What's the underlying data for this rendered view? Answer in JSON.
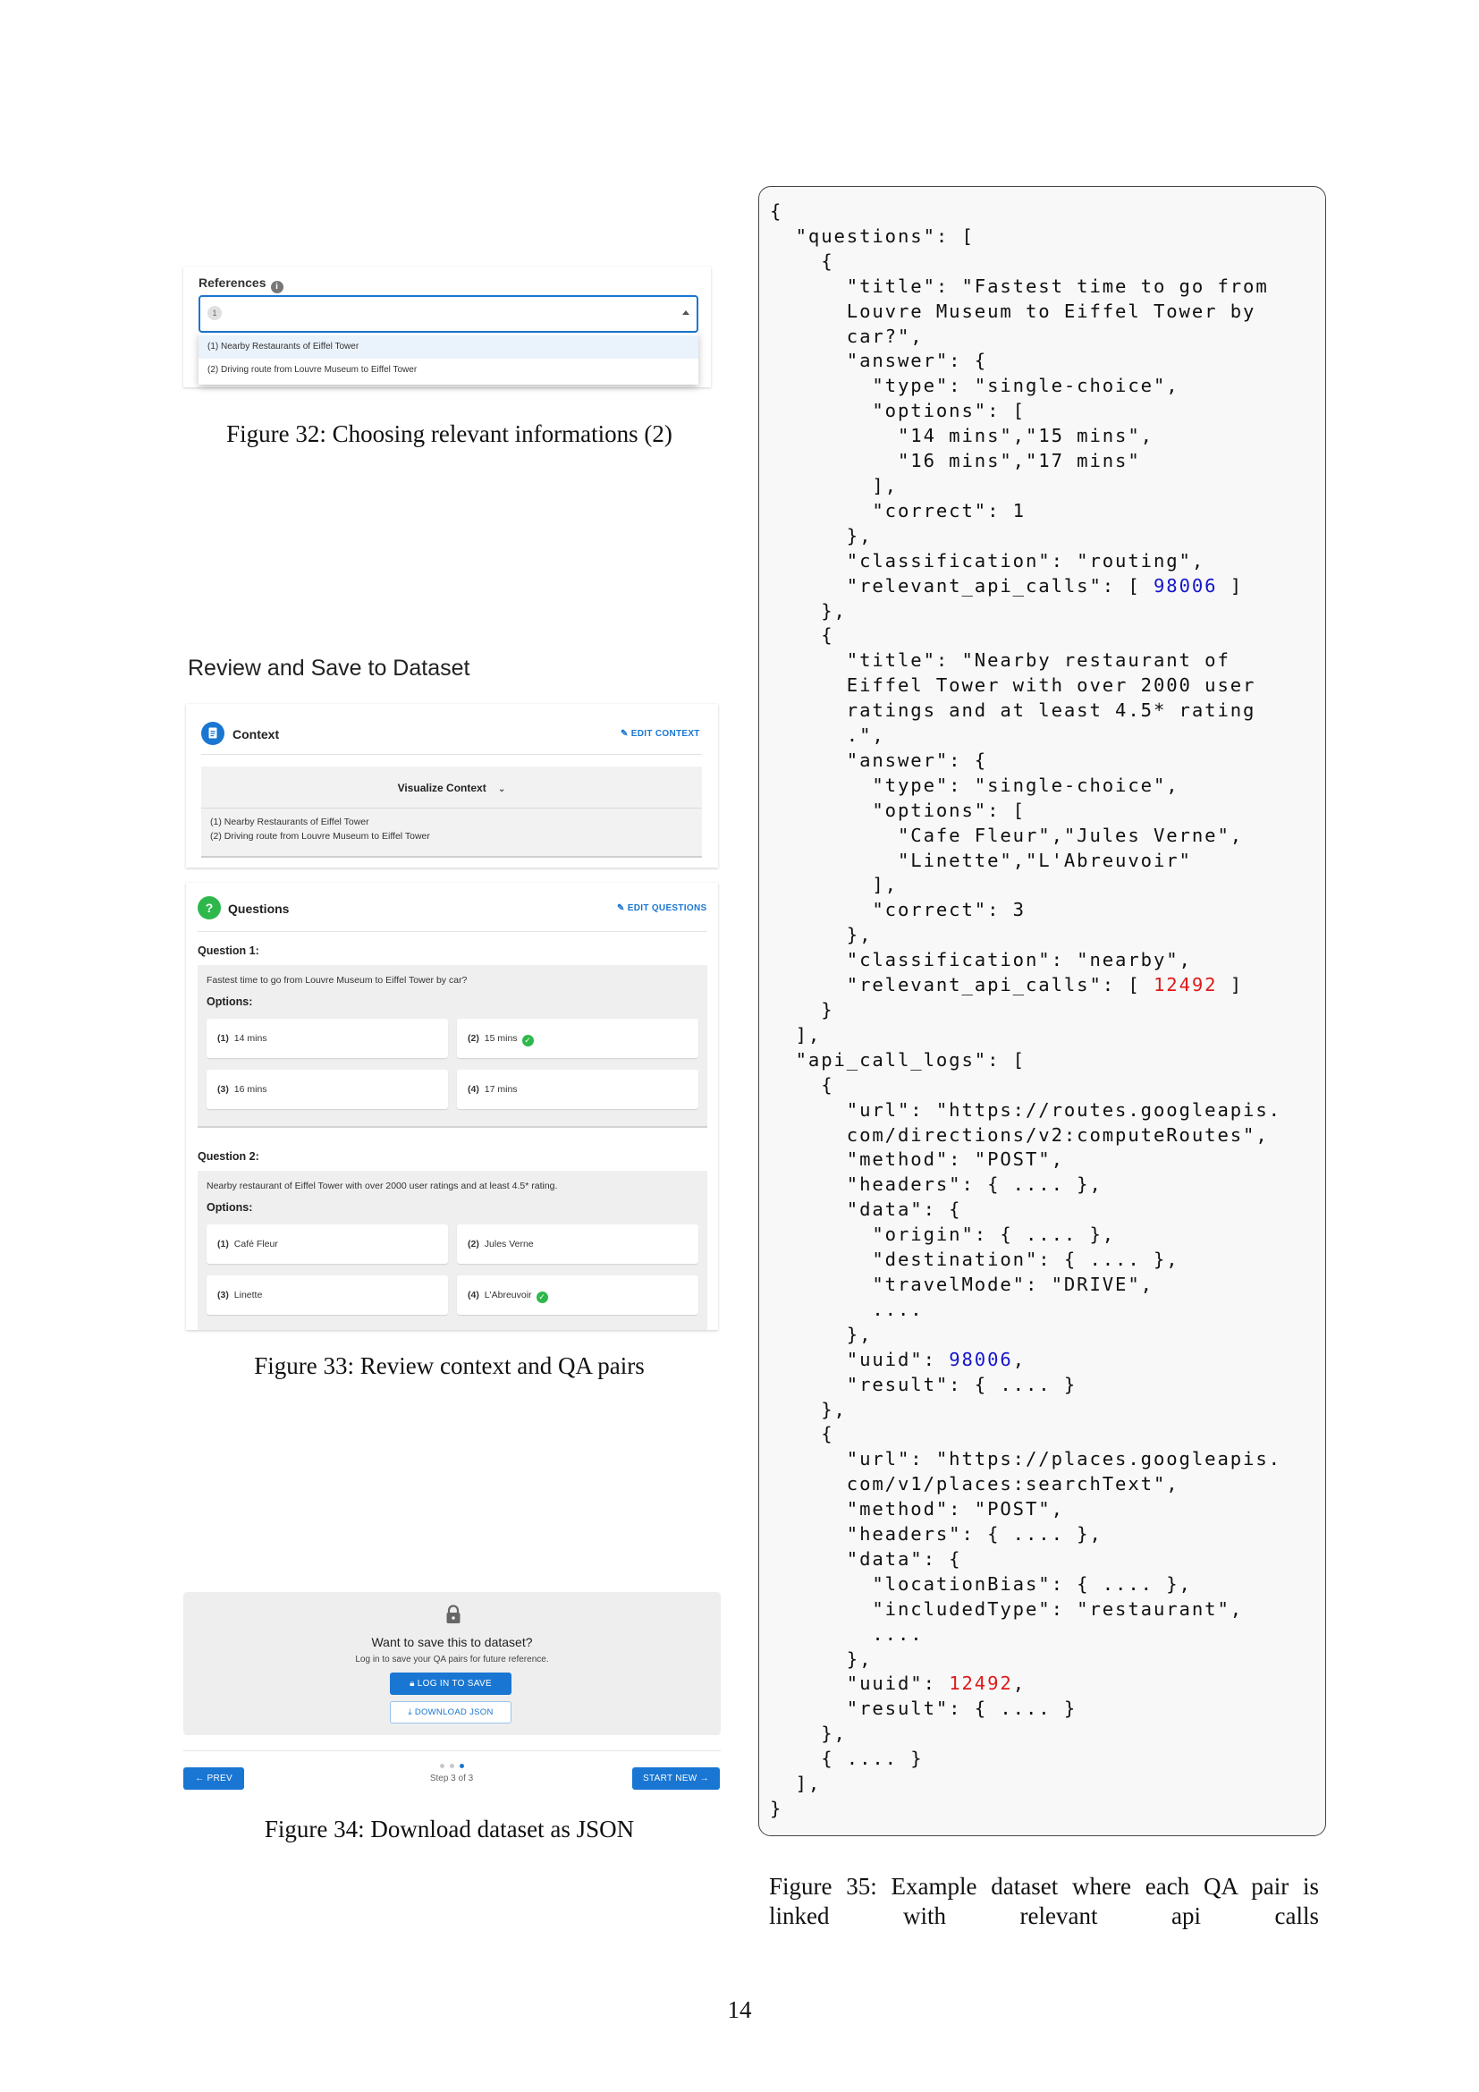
{
  "fig32": {
    "references_label": "References",
    "info_glyph": "i",
    "selected_chip": "1",
    "options": [
      "(1) Nearby Restaurants of Eiffel Tower",
      "(2) Driving route from Louvre Museum to Eiffel Tower"
    ],
    "caption": "Figure 32: Choosing relevant informations (2)"
  },
  "fig33": {
    "section_title": "Review and Save to Dataset",
    "context": {
      "label": "Context",
      "edit_label": "EDIT CONTEXT",
      "visualize_label": "Visualize Context",
      "items": [
        "(1) Nearby Restaurants of Eiffel Tower",
        "(2) Driving route from Louvre Museum to Eiffel Tower"
      ]
    },
    "questions": {
      "label": "Questions",
      "icon_glyph": "?",
      "edit_label": "EDIT QUESTIONS",
      "options_heading": "Options:",
      "list": [
        {
          "label": "Question 1:",
          "text": "Fastest time to go from Louvre Museum to Eiffel Tower by car?",
          "options": [
            {
              "num": "(1)",
              "text": "14 mins",
              "correct": false
            },
            {
              "num": "(2)",
              "text": "15 mins",
              "correct": true
            },
            {
              "num": "(3)",
              "text": "16 mins",
              "correct": false
            },
            {
              "num": "(4)",
              "text": "17 mins",
              "correct": false
            }
          ]
        },
        {
          "label": "Question 2:",
          "text": "Nearby restaurant of Eiffel Tower with over 2000 user ratings and at least 4.5* rating.",
          "options": [
            {
              "num": "(1)",
              "text": "Café Fleur",
              "correct": false
            },
            {
              "num": "(2)",
              "text": "Jules Verne",
              "correct": false
            },
            {
              "num": "(3)",
              "text": "Linette",
              "correct": false
            },
            {
              "num": "(4)",
              "text": "L'Abreuvoir",
              "correct": true
            }
          ]
        }
      ]
    },
    "caption": "Figure 33: Review context and QA pairs"
  },
  "fig34": {
    "save_title": "Want to save this to dataset?",
    "save_sub": "Log in to save your QA pairs for future reference.",
    "login_button": "LOG IN TO SAVE",
    "download_button": "DOWNLOAD JSON",
    "prev_button": "PREV",
    "step_text": "Step 3 of 3",
    "start_new_button": "START NEW",
    "caption": "Figure 34: Download dataset as JSON"
  },
  "fig35": {
    "code_lines": [
      "{",
      "  \"questions\": [",
      "    {",
      "      \"title\": \"Fastest time to go from",
      "      Louvre Museum to Eiffel Tower by",
      "      car?\",",
      "      \"answer\": {",
      "        \"type\": \"single-choice\",",
      "        \"options\": [",
      "          \"14 mins\",\"15 mins\",",
      "          \"16 mins\",\"17 mins\"",
      "        ],",
      "        \"correct\": 1",
      "      },",
      "      \"classification\": \"routing\",",
      "      \"relevant_api_calls\": [ ",
      "    },",
      "    {",
      "      \"title\": \"Nearby restaurant of",
      "      Eiffel Tower with over 2000 user",
      "      ratings and at least 4.5* rating",
      "      .\",",
      "      \"answer\": {",
      "        \"type\": \"single-choice\",",
      "        \"options\": [",
      "          \"Cafe Fleur\",\"Jules Verne\",",
      "          \"Linette\",\"L'Abreuvoir\"",
      "        ],",
      "        \"correct\": 3",
      "      },",
      "      \"classification\": \"nearby\",",
      "      \"relevant_api_calls\": [ ",
      "    }",
      "  ],",
      "  \"api_call_logs\": [",
      "    {",
      "      \"url\": \"https://routes.googleapis.",
      "      com/directions/v2:computeRoutes\",",
      "      \"method\": \"POST\",",
      "      \"headers\": { .... },",
      "      \"data\": {",
      "        \"origin\": { .... },",
      "        \"destination\": { .... },",
      "        \"travelMode\": \"DRIVE\",",
      "        ....",
      "      },",
      "      \"uuid\": ",
      "      \"result\": { .... }",
      "    },",
      "    {",
      "      \"url\": \"https://places.googleapis.",
      "      com/v1/places:searchText\",",
      "      \"method\": \"POST\",",
      "      \"headers\": { .... },",
      "      \"data\": {",
      "        \"locationBias\": { .... },",
      "        \"includedType\": \"restaurant\",",
      "        ....",
      "      },",
      "      \"uuid\": ",
      "      \"result\": { .... }",
      "    },",
      "    { .... }",
      "  ],",
      "}"
    ],
    "highlights": {
      "15": {
        "value": "98006",
        "color": "blue",
        "suffix": " ]"
      },
      "31": {
        "value": "12492",
        "color": "red",
        "suffix": " ]"
      },
      "46": {
        "value": "98006",
        "color": "blue",
        "suffix": ","
      },
      "59": {
        "value": "12492",
        "color": "red",
        "suffix": ","
      }
    },
    "caption": "Figure 35: Example dataset where each QA pair is linked with relevant api calls"
  },
  "page_number": "14",
  "colors": {
    "accent": "#1976d2",
    "success": "#2eb84b",
    "num_blue": "#1515cc",
    "num_red": "#dd1a1a"
  }
}
